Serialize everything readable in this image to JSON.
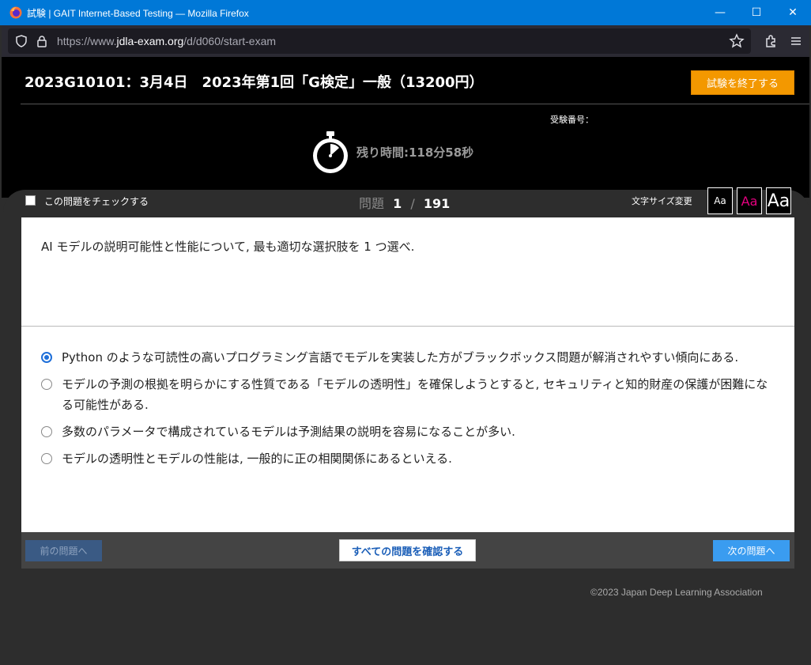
{
  "window": {
    "title": "試験 | GAIT Internet-Based Testing — Mozilla Firefox",
    "minimize": "—",
    "maximize": "☐",
    "close": "✕"
  },
  "browser": {
    "url_prefix": "https://www.",
    "url_host": "jdla-exam.org",
    "url_path": "/d/d060/start-exam"
  },
  "exam": {
    "title": "2023G10101：3月4日　2023年第1回「G検定」一般（13200円）",
    "end_button": "試験を終了する",
    "candidate_label": "受験番号：",
    "timer": "残り時間:118分58秒"
  },
  "question_bar": {
    "check_label": "この問題をチェックする",
    "question_label": "問題",
    "current": "1",
    "separator": "/",
    "total": "191",
    "font_size_label": "文字サイズ変更",
    "font_small": "Aa",
    "font_medium": "Aa",
    "font_large": "Aa"
  },
  "question": {
    "text": "AI モデルの説明可能性と性能について, 最も適切な選択肢を 1 つ選べ.",
    "options": [
      {
        "text": "Python のような可読性の高いプログラミング言語でモデルを実装した方がブラックボックス問題が解消されやすい傾向にある.",
        "selected": true
      },
      {
        "text": "モデルの予測の根拠を明らかにする性質である「モデルの透明性」を確保しようとすると, セキュリティと知的財産の保護が困難になる可能性がある.",
        "selected": false
      },
      {
        "text": "多数のパラメータで構成されているモデルは予測結果の説明を容易になることが多い.",
        "selected": false
      },
      {
        "text": "モデルの透明性とモデルの性能は, 一般的に正の相関関係にあるといえる.",
        "selected": false
      }
    ]
  },
  "footer": {
    "prev": "前の問題へ",
    "review_all": "すべての問題を確認する",
    "next": "次の問題へ",
    "copyright": "©2023 Japan Deep Learning Association"
  }
}
